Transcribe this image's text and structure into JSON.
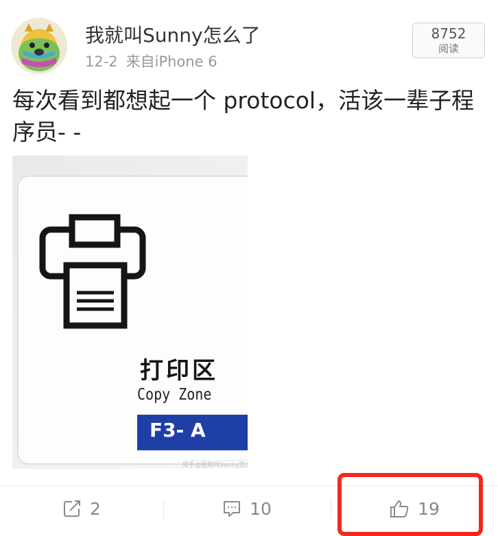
{
  "post": {
    "username": "我就叫Sunny怎么了",
    "date": "12-2",
    "source": "来自iPhone 6",
    "read_count": "8752",
    "read_label": "阅读",
    "text": "每次看到都想起一个 protocol，活该一辈子程序员- -"
  },
  "photo": {
    "sign_zh": "打印区",
    "sign_en": "Copy Zone",
    "room": "F3- A",
    "watermark": "知乎@我就叫Sunny怎么了"
  },
  "actions": {
    "repost_count": "2",
    "comment_count": "10",
    "like_count": "19"
  },
  "colors": {
    "highlight": "#f2281e",
    "sign_blue": "#1f3fa8"
  }
}
